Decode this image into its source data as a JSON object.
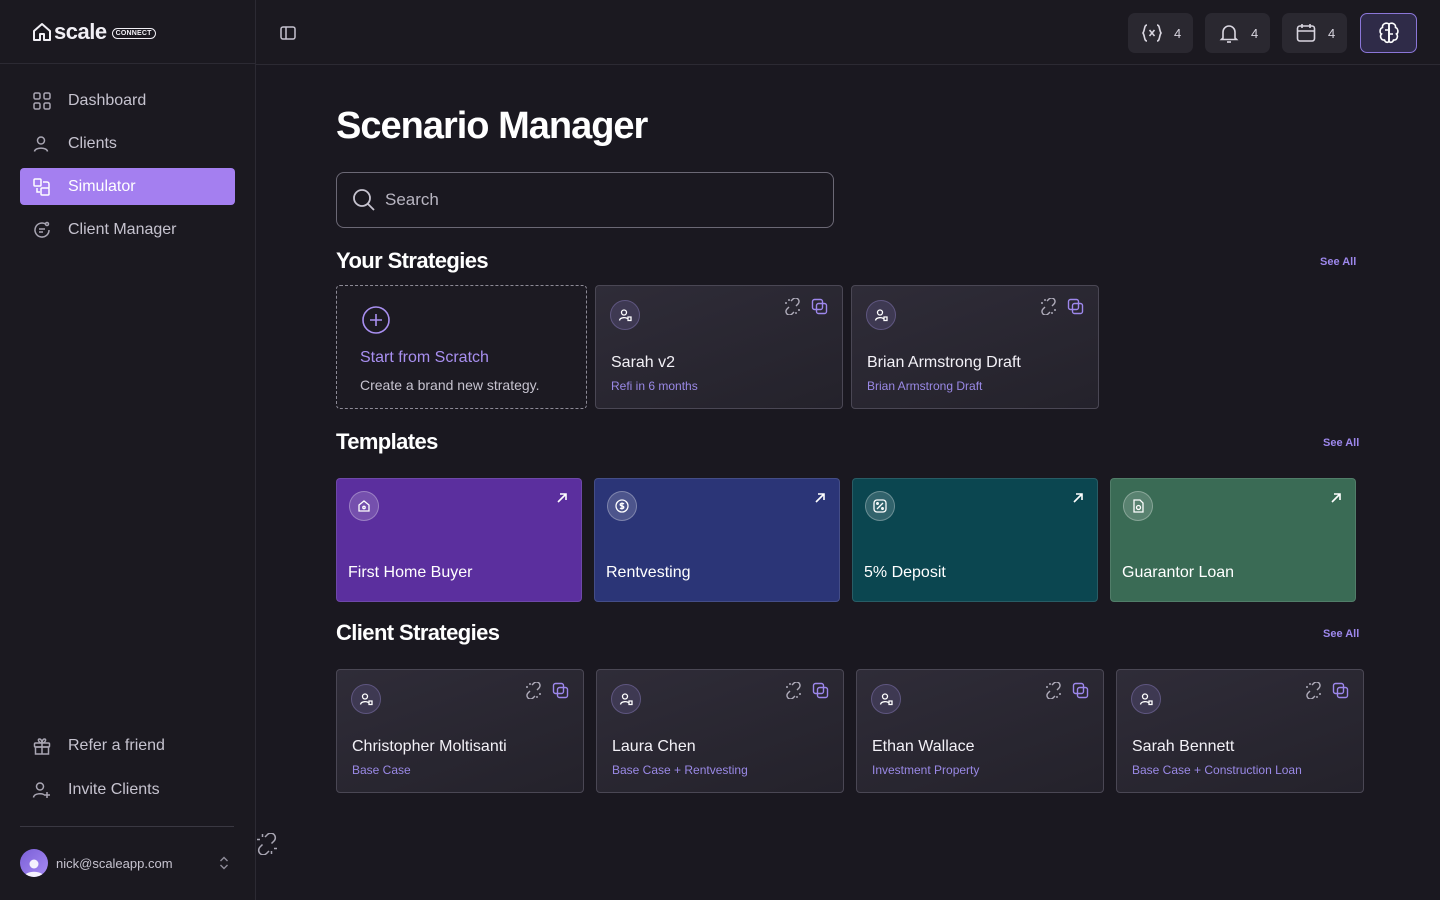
{
  "app": {
    "logo_word": "scale",
    "logo_badge": "CONNECT"
  },
  "sidebar": {
    "items": [
      {
        "label": "Dashboard",
        "icon": "grid-icon"
      },
      {
        "label": "Clients",
        "icon": "user-icon"
      },
      {
        "label": "Simulator",
        "icon": "simulator-icon",
        "active": true
      },
      {
        "label": "Client Manager",
        "icon": "client-manager-icon"
      }
    ],
    "bottom_items": [
      {
        "label": "Refer a friend",
        "icon": "gift-icon"
      },
      {
        "label": "Invite Clients",
        "icon": "user-plus-icon"
      }
    ],
    "user_email": "nick@scaleapp.com"
  },
  "topbar": {
    "variables_count": "4",
    "notifications_count": "4",
    "calendar_count": "4"
  },
  "main": {
    "title": "Scenario Manager",
    "search_placeholder": "Search",
    "your_strategies": {
      "title": "Your Strategies",
      "see_all": "See All",
      "scratch_title": "Start from Scratch",
      "scratch_sub": "Create a brand new strategy.",
      "cards": [
        {
          "title": "Sarah v2",
          "sub": "Refi in 6 months"
        },
        {
          "title": "Brian Armstrong Draft",
          "sub": "Brian Armstrong Draft"
        }
      ]
    },
    "templates": {
      "title": "Templates",
      "see_all": "See All",
      "items": [
        {
          "title": "First Home Buyer",
          "color": "#5b2f9e"
        },
        {
          "title": "Rentvesting",
          "color": "#2b3577"
        },
        {
          "title": "5% Deposit",
          "color": "#0b4650"
        },
        {
          "title": "Guarantor Loan",
          "color": "#3a6b55"
        }
      ]
    },
    "client_strategies": {
      "title": "Client Strategies",
      "see_all": "See All",
      "cards": [
        {
          "title": "Christopher Moltisanti",
          "sub": "Base Case"
        },
        {
          "title": "Laura Chen",
          "sub": "Base Case + Rentvesting"
        },
        {
          "title": "Ethan Wallace",
          "sub": "Investment Property"
        },
        {
          "title": "Sarah Bennett",
          "sub": "Base Case + Construction Loan"
        }
      ]
    }
  },
  "colors": {
    "accent": "#a47ff0",
    "background": "#1a1820"
  }
}
